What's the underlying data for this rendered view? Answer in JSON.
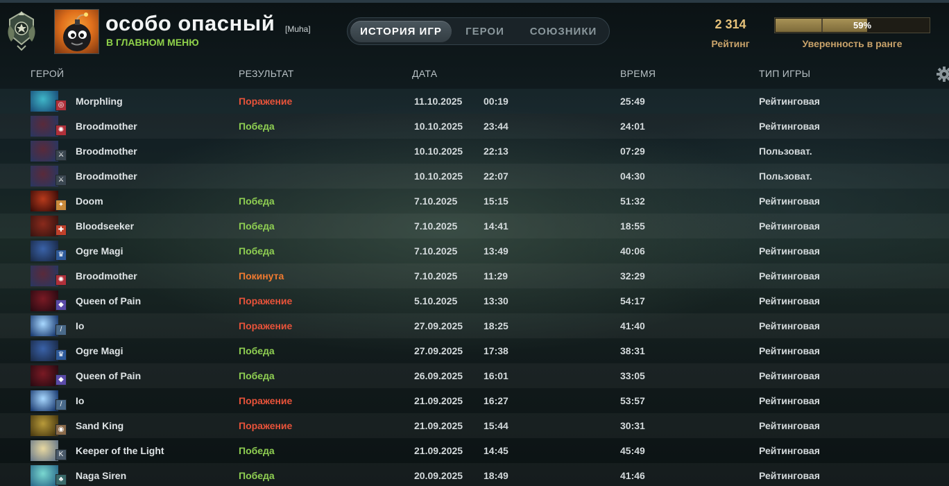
{
  "profile": {
    "name": "особо опасный",
    "tag": "[Muha]",
    "status": "В ГЛАВНОМ МЕНЮ",
    "rank_medal_icon": "rank-medal-icon",
    "avatar_icon": "bomb-avatar-icon"
  },
  "tabs": [
    {
      "label": "ИСТОРИЯ ИГР",
      "active": true
    },
    {
      "label": "ГЕРОИ",
      "active": false
    },
    {
      "label": "СОЮЗНИКИ",
      "active": false
    }
  ],
  "rating": {
    "value": "2 314",
    "label": "Рейтинг"
  },
  "confidence": {
    "percent_text": "59%",
    "fraction": 0.59,
    "label": "Уверенность в ранге"
  },
  "columns": {
    "hero": "ГЕРОЙ",
    "result": "РЕЗУЛЬТАТ",
    "date": "ДАТА",
    "duration": "ВРЕМЯ",
    "game_type": "ТИП ИГРЫ"
  },
  "settings_icon": "gear-icon",
  "colors": {
    "win": "#8fcf52",
    "loss": "#e8533a",
    "abandon": "#f07a30",
    "accent_gold": "#e6c27a"
  },
  "matches": [
    {
      "hero": "Morphling",
      "result": "Поражение",
      "result_type": "loss",
      "date": "11.10.2025",
      "time": "00:19",
      "duration": "25:49",
      "game_type": "Рейтинговая",
      "portrait_colors": [
        "#3fb6c8",
        "#1a4f7a"
      ],
      "badge_color": "#b0303a",
      "badge_glyph": "◎"
    },
    {
      "hero": "Broodmother",
      "result": "Победа",
      "result_type": "win",
      "date": "10.10.2025",
      "time": "23:44",
      "duration": "24:01",
      "game_type": "Рейтинговая",
      "portrait_colors": [
        "#5a2a3a",
        "#2a3660"
      ],
      "badge_color": "#b0303a",
      "badge_glyph": "✺"
    },
    {
      "hero": "Broodmother",
      "result": "",
      "result_type": "none",
      "date": "10.10.2025",
      "time": "22:13",
      "duration": "07:29",
      "game_type": "Пользоват.",
      "portrait_colors": [
        "#5a2a3a",
        "#2a3660"
      ],
      "badge_color": "#3a4650",
      "badge_glyph": "⚔"
    },
    {
      "hero": "Broodmother",
      "result": "",
      "result_type": "none",
      "date": "10.10.2025",
      "time": "22:07",
      "duration": "04:30",
      "game_type": "Пользоват.",
      "portrait_colors": [
        "#5a2a3a",
        "#2a3660"
      ],
      "badge_color": "#3a4650",
      "badge_glyph": "⚔"
    },
    {
      "hero": "Doom",
      "result": "Победа",
      "result_type": "win",
      "date": "7.10.2025",
      "time": "15:15",
      "duration": "51:32",
      "game_type": "Рейтинговая",
      "portrait_colors": [
        "#b83a1c",
        "#3a0c08"
      ],
      "badge_color": "#c98a3a",
      "badge_glyph": "✦"
    },
    {
      "hero": "Bloodseeker",
      "result": "Победа",
      "result_type": "win",
      "date": "7.10.2025",
      "time": "14:41",
      "duration": "18:55",
      "game_type": "Рейтинговая",
      "portrait_colors": [
        "#8a2a1c",
        "#3a1410"
      ],
      "badge_color": "#c0402a",
      "badge_glyph": "✚"
    },
    {
      "hero": "Ogre Magi",
      "result": "Победа",
      "result_type": "win",
      "date": "7.10.2025",
      "time": "13:49",
      "duration": "40:06",
      "game_type": "Рейтинговая",
      "portrait_colors": [
        "#3a62a8",
        "#1a2a48"
      ],
      "badge_color": "#2e5a9a",
      "badge_glyph": "♛"
    },
    {
      "hero": "Broodmother",
      "result": "Покинута",
      "result_type": "abandon",
      "date": "7.10.2025",
      "time": "11:29",
      "duration": "32:29",
      "game_type": "Рейтинговая",
      "portrait_colors": [
        "#5a2a3a",
        "#2a3660"
      ],
      "badge_color": "#b0303a",
      "badge_glyph": "✺"
    },
    {
      "hero": "Queen of Pain",
      "result": "Поражение",
      "result_type": "loss",
      "date": "5.10.2025",
      "time": "13:30",
      "duration": "54:17",
      "game_type": "Рейтинговая",
      "portrait_colors": [
        "#7a1a24",
        "#2a0a12"
      ],
      "badge_color": "#5a4aa8",
      "badge_glyph": "◆"
    },
    {
      "hero": "Io",
      "result": "Поражение",
      "result_type": "loss",
      "date": "27.09.2025",
      "time": "18:25",
      "duration": "41:40",
      "game_type": "Рейтинговая",
      "portrait_colors": [
        "#a8d8ff",
        "#1a3a70"
      ],
      "badge_color": "#4a6a8a",
      "badge_glyph": "/"
    },
    {
      "hero": "Ogre Magi",
      "result": "Победа",
      "result_type": "win",
      "date": "27.09.2025",
      "time": "17:38",
      "duration": "38:31",
      "game_type": "Рейтинговая",
      "portrait_colors": [
        "#3a62a8",
        "#1a2a48"
      ],
      "badge_color": "#2e5a9a",
      "badge_glyph": "♛"
    },
    {
      "hero": "Queen of Pain",
      "result": "Победа",
      "result_type": "win",
      "date": "26.09.2025",
      "time": "16:01",
      "duration": "33:05",
      "game_type": "Рейтинговая",
      "portrait_colors": [
        "#7a1a24",
        "#2a0a12"
      ],
      "badge_color": "#5a4aa8",
      "badge_glyph": "◆"
    },
    {
      "hero": "Io",
      "result": "Поражение",
      "result_type": "loss",
      "date": "21.09.2025",
      "time": "16:27",
      "duration": "53:57",
      "game_type": "Рейтинговая",
      "portrait_colors": [
        "#a8d8ff",
        "#1a3a70"
      ],
      "badge_color": "#4a6a8a",
      "badge_glyph": "/"
    },
    {
      "hero": "Sand King",
      "result": "Поражение",
      "result_type": "loss",
      "date": "21.09.2025",
      "time": "15:44",
      "duration": "30:31",
      "game_type": "Рейтинговая",
      "portrait_colors": [
        "#b89a3a",
        "#4a3a10"
      ],
      "badge_color": "#8a6a4a",
      "badge_glyph": "◉"
    },
    {
      "hero": "Keeper of the Light",
      "result": "Победа",
      "result_type": "win",
      "date": "21.09.2025",
      "time": "14:45",
      "duration": "45:49",
      "game_type": "Рейтинговая",
      "portrait_colors": [
        "#e8d8a0",
        "#6a7a8a"
      ],
      "badge_color": "#4a5a6a",
      "badge_glyph": "K"
    },
    {
      "hero": "Naga Siren",
      "result": "Победа",
      "result_type": "win",
      "date": "20.09.2025",
      "time": "18:49",
      "duration": "41:46",
      "game_type": "Рейтинговая",
      "portrait_colors": [
        "#7ad8d0",
        "#2a6a8a"
      ],
      "badge_color": "#3a6a6a",
      "badge_glyph": "♣"
    }
  ]
}
